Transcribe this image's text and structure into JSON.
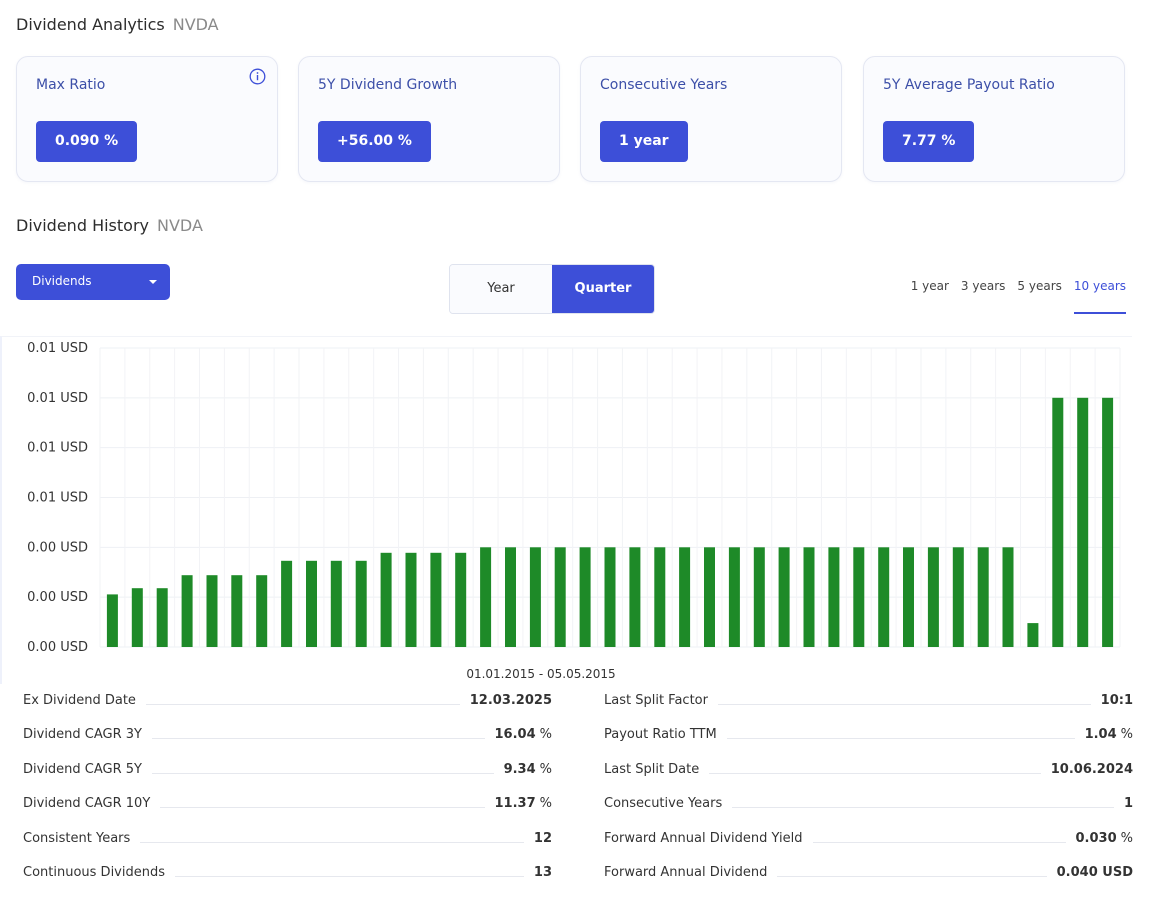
{
  "analytics": {
    "title": "Dividend Analytics",
    "ticker": "NVDA",
    "cards": [
      {
        "label": "Max Ratio",
        "value": "0.090 %"
      },
      {
        "label": "5Y Dividend Growth",
        "value": "+56.00 %"
      },
      {
        "label": "Consecutive Years",
        "value": "1 year"
      },
      {
        "label": "5Y Average Payout Ratio",
        "value": "7.77 %"
      }
    ]
  },
  "history": {
    "title": "Dividend History",
    "ticker": "NVDA",
    "dropdown": {
      "selected": "Dividends"
    },
    "period_toggle": {
      "options": [
        "Year",
        "Quarter"
      ],
      "selected": "Quarter"
    },
    "range_tabs": {
      "options": [
        "1 year",
        "3 years",
        "5 years",
        "10 years"
      ],
      "selected": "10 years"
    }
  },
  "chart_data": {
    "type": "bar",
    "y_tick_labels": [
      "0.01 USD",
      "0.01 USD",
      "0.01 USD",
      "0.01 USD",
      "0.00 USD",
      "0.00 USD",
      "0.00 USD"
    ],
    "ylim": [
      0,
      0.012
    ],
    "xlabel": "01.01.2015 - 05.05.2015",
    "values": [
      0.00211,
      0.00236,
      0.00236,
      0.00288,
      0.00288,
      0.00288,
      0.00288,
      0.00346,
      0.00346,
      0.00346,
      0.00346,
      0.00378,
      0.00378,
      0.00378,
      0.00378,
      0.004,
      0.004,
      0.004,
      0.004,
      0.004,
      0.004,
      0.004,
      0.004,
      0.004,
      0.004,
      0.004,
      0.004,
      0.004,
      0.004,
      0.004,
      0.004,
      0.004,
      0.004,
      0.004,
      0.004,
      0.004,
      0.004,
      0.00096,
      0.01,
      0.01,
      0.01
    ],
    "bar_color": "#1e8a28",
    "grid": true
  },
  "stats": {
    "left": [
      {
        "label": "Ex Dividend Date",
        "value": "12.03.2025",
        "unit": ""
      },
      {
        "label": "Dividend CAGR 3Y",
        "value": "16.04",
        "unit": "%"
      },
      {
        "label": "Dividend CAGR 5Y",
        "value": "9.34",
        "unit": "%"
      },
      {
        "label": "Dividend CAGR 10Y",
        "value": "11.37",
        "unit": "%"
      },
      {
        "label": "Consistent Years",
        "value": "12",
        "unit": ""
      },
      {
        "label": "Continuous Dividends",
        "value": "13",
        "unit": ""
      }
    ],
    "right": [
      {
        "label": "Last Split Factor",
        "value": "10:1",
        "unit": ""
      },
      {
        "label": "Payout Ratio TTM",
        "value": "1.04",
        "unit": "%"
      },
      {
        "label": "Last Split Date",
        "value": "10.06.2024",
        "unit": ""
      },
      {
        "label": "Consecutive Years",
        "value": "1",
        "unit": ""
      },
      {
        "label": "Forward Annual Dividend Yield",
        "value": "0.030",
        "unit": "%"
      },
      {
        "label": "Forward Annual Dividend",
        "value": "0.040 USD",
        "unit": ""
      }
    ]
  },
  "colors": {
    "accent": "#3d4fd8",
    "bar": "#1e8a28"
  }
}
